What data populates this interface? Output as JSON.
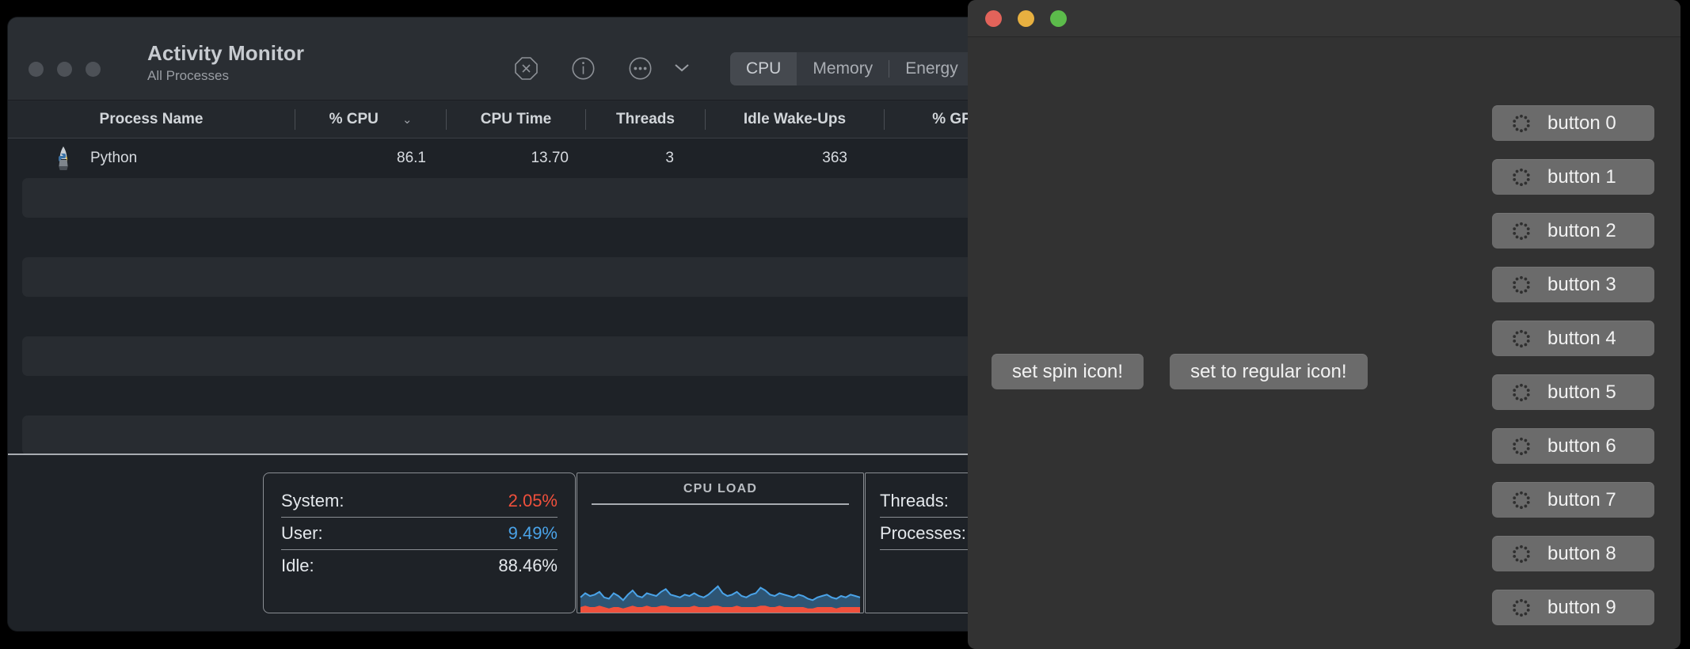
{
  "activity_monitor": {
    "title": "Activity Monitor",
    "subtitle": "All Processes",
    "toolbar": {
      "stop_icon": "octagon-x-icon",
      "info_icon": "info-circle-icon",
      "more_icon": "ellipsis-circle-icon",
      "chevron_icon": "chevron-down-icon"
    },
    "tabs": [
      {
        "label": "CPU",
        "selected": true
      },
      {
        "label": "Memory",
        "selected": false
      },
      {
        "label": "Energy",
        "selected": false
      }
    ],
    "columns": [
      "Process Name",
      "% CPU",
      "CPU Time",
      "Threads",
      "Idle Wake-Ups",
      "% GP"
    ],
    "sort_indicator": "⌄",
    "rows": [
      {
        "icon": "python-icon",
        "process_name": "Python",
        "cpu": "86.1",
        "cpu_time": "13.70",
        "threads": "3",
        "idle_wake_ups": "363"
      }
    ],
    "stats": [
      {
        "label": "System:",
        "value": "2.05%",
        "color": "#f0503c"
      },
      {
        "label": "User:",
        "value": "9.49%",
        "color": "#4aa3e8"
      },
      {
        "label": "Idle:",
        "value": "88.46%",
        "color": "#e4e8ec"
      }
    ],
    "graph": {
      "title": "CPU LOAD",
      "user_color": "#4aa3e8",
      "system_color": "#f0503c"
    },
    "right_stats": [
      {
        "label": "Threads:"
      },
      {
        "label": "Processes:"
      }
    ]
  },
  "front_window": {
    "center_buttons": [
      {
        "label": "set spin icon!"
      },
      {
        "label": "set to regular icon!"
      }
    ],
    "spin_buttons": [
      {
        "label": "button 0",
        "icon": "spinner-icon"
      },
      {
        "label": "button 1",
        "icon": "spinner-icon"
      },
      {
        "label": "button 2",
        "icon": "spinner-icon"
      },
      {
        "label": "button 3",
        "icon": "spinner-icon"
      },
      {
        "label": "button 4",
        "icon": "spinner-icon"
      },
      {
        "label": "button 5",
        "icon": "spinner-icon"
      },
      {
        "label": "button 6",
        "icon": "spinner-icon"
      },
      {
        "label": "button 7",
        "icon": "spinner-icon"
      },
      {
        "label": "button 8",
        "icon": "spinner-icon"
      },
      {
        "label": "button 9",
        "icon": "spinner-icon"
      }
    ]
  },
  "chart_data": {
    "type": "area",
    "title": "CPU LOAD",
    "xlabel": "",
    "ylabel": "",
    "ylim": [
      0,
      100
    ],
    "series": [
      {
        "name": "User",
        "color": "#4aa3e8",
        "values": [
          11,
          14,
          12,
          13,
          15,
          11,
          10,
          14,
          12,
          9,
          13,
          16,
          12,
          11,
          14,
          13,
          12,
          15,
          17,
          13,
          12,
          11,
          13,
          12,
          14,
          12,
          11,
          13,
          16,
          19,
          14,
          12,
          13,
          15,
          12,
          11,
          13,
          14,
          18,
          16,
          13,
          12,
          14,
          13,
          12,
          11,
          13,
          12,
          10,
          9,
          11,
          12,
          13,
          11,
          10,
          12,
          11,
          13,
          12,
          11
        ]
      },
      {
        "name": "System",
        "color": "#f0503c",
        "values": [
          4,
          5,
          4,
          4,
          5,
          4,
          3,
          4,
          4,
          3,
          4,
          5,
          4,
          4,
          5,
          4,
          4,
          5,
          5,
          4,
          4,
          4,
          4,
          4,
          5,
          4,
          4,
          4,
          5,
          5,
          4,
          4,
          4,
          5,
          4,
          4,
          4,
          4,
          5,
          5,
          4,
          4,
          5,
          4,
          4,
          4,
          4,
          4,
          3,
          3,
          4,
          4,
          4,
          4,
          3,
          4,
          4,
          4,
          4,
          4
        ]
      }
    ],
    "legend_position": "none",
    "grid": false
  }
}
